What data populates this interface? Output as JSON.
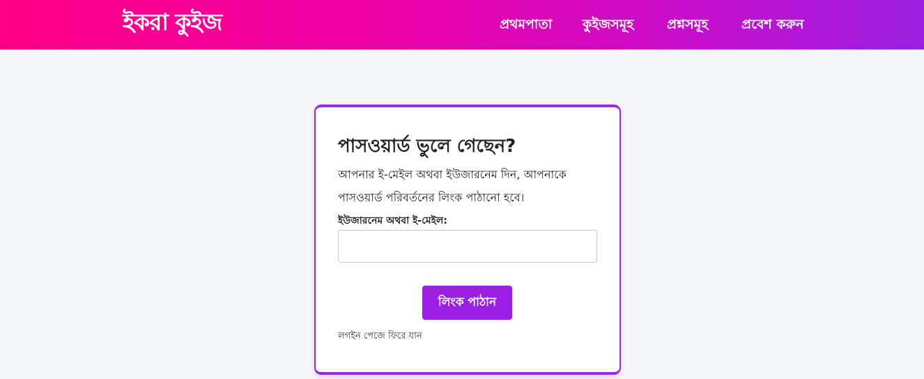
{
  "navbar": {
    "brand": "ইকরা কুইজ",
    "links": [
      {
        "label": "প্রথমপাতা"
      },
      {
        "label": "কুইজসমূহ"
      },
      {
        "label": "প্রশ্নসমূহ"
      },
      {
        "label": "প্রবেশ করুন"
      }
    ]
  },
  "form": {
    "title": "পাসওয়ার্ড ভুলে গেছেন?",
    "description": "আপনার ই-মেইল অথবা ইউজারনেম দিন, আপনাকে পাসওয়ার্ড পরিবর্তনের লিংক পাঠানো হবে।",
    "field_label": "ইউজারনেম অথবা ই-মেইল:",
    "field_value": "",
    "submit_label": "লিংক পাঠান",
    "back_link": "লগইন পেজে ফিরে যান"
  },
  "colors": {
    "navbar_gradient_start": "#ff0084",
    "navbar_gradient_end": "#9a20e0",
    "accent": "#9b20e3",
    "page_background": "#f5f8fb"
  }
}
